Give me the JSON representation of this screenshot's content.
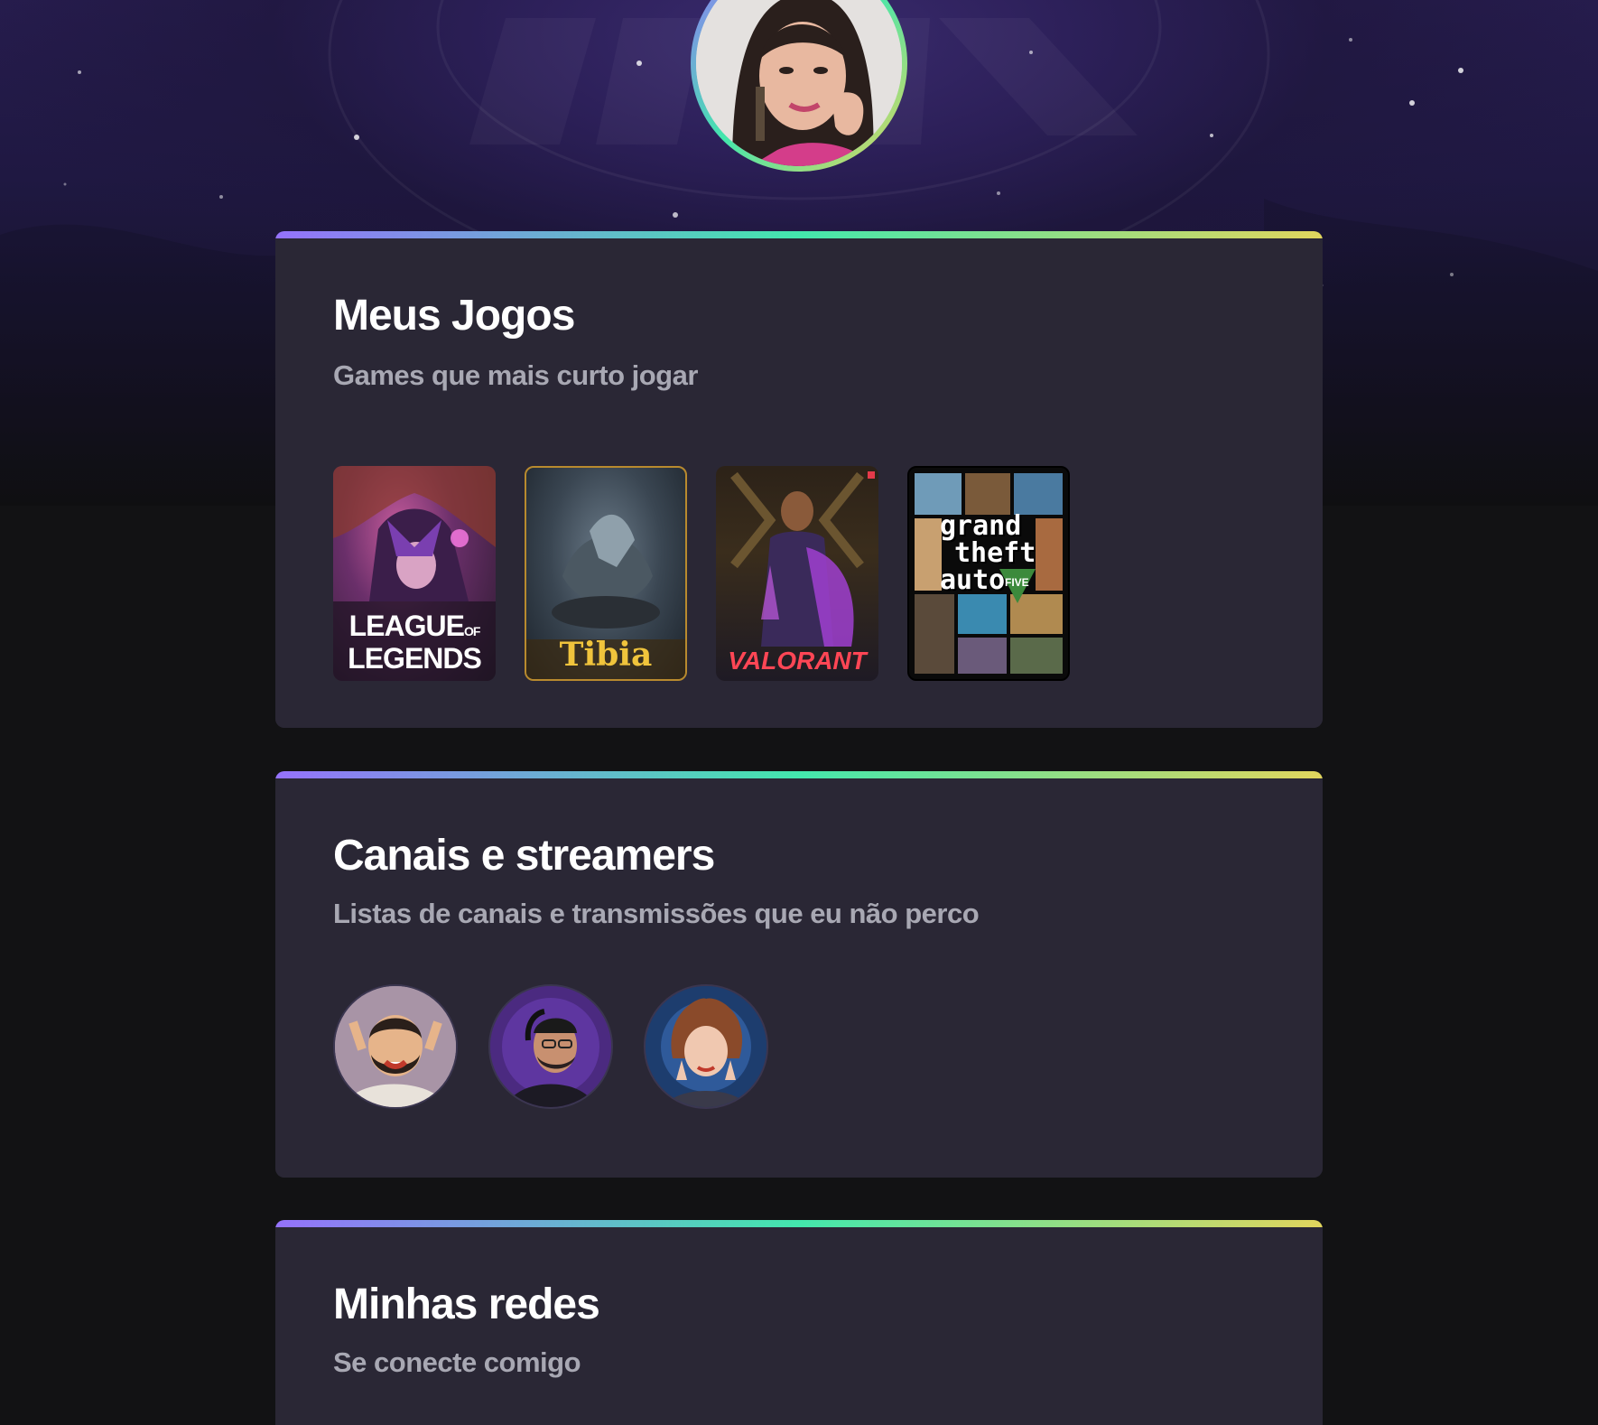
{
  "profile": {
    "avatar_icon": "profile-photo"
  },
  "colors": {
    "gradient_start": "#9572fc",
    "gradient_mid": "#43e7ad",
    "gradient_end": "#e1d55d",
    "card_bg": "#2a2735",
    "page_bg": "#121214",
    "subtitle": "#a8a8b3"
  },
  "games_section": {
    "title": "Meus Jogos",
    "subtitle": "Games que mais curto jogar",
    "games": [
      {
        "name": "League of Legends",
        "label_line1": "LEAGUE",
        "label_of": "OF",
        "label_line2": "LEGENDS"
      },
      {
        "name": "Tibia",
        "label": "Tibia"
      },
      {
        "name": "Valorant",
        "label": "VALORANT"
      },
      {
        "name": "Grand Theft Auto V",
        "label_line1": "grand",
        "label_line2": "theft",
        "label_line3": "auto",
        "label_five": "FIVE"
      }
    ]
  },
  "streamers_section": {
    "title": "Canais e streamers",
    "subtitle": "Listas de canais e transmissões que eu não perco",
    "streamers": [
      {
        "icon": "streamer-avatar-1"
      },
      {
        "icon": "streamer-avatar-2"
      },
      {
        "icon": "streamer-avatar-3"
      }
    ]
  },
  "social_section": {
    "title": "Minhas redes",
    "subtitle": "Se conecte comigo"
  }
}
